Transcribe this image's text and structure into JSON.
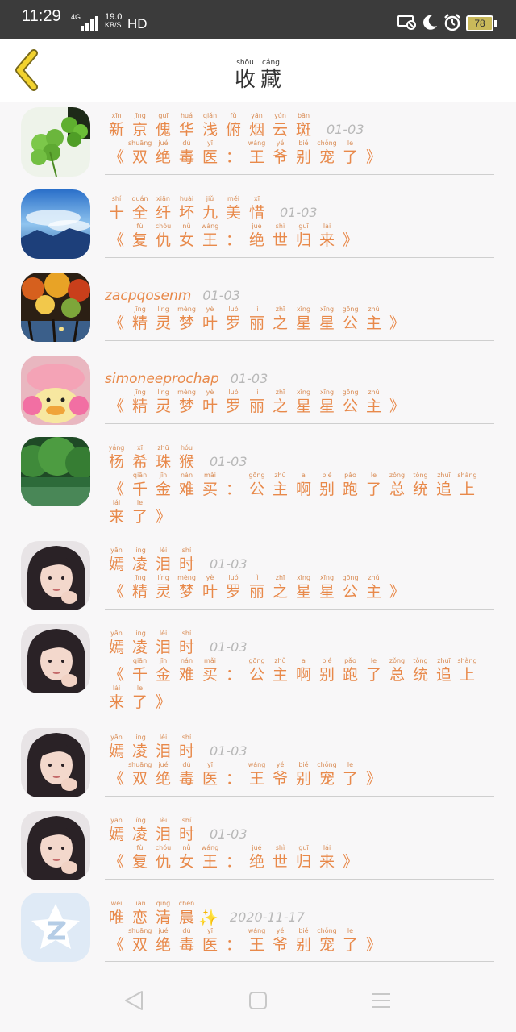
{
  "status_bar": {
    "time": "11:29",
    "network": "4G",
    "speed_value": "19.0",
    "speed_unit": "KB/S",
    "hd": "HD",
    "battery": "78",
    "icons": [
      "screen-cast-icon",
      "moon-icon",
      "alarm-icon"
    ]
  },
  "header": {
    "back_icon": "chevron-left-icon",
    "title": [
      {
        "py": "shōu",
        "hz": "收"
      },
      {
        "py": "cáng",
        "hz": "藏"
      }
    ]
  },
  "items": [
    {
      "name": [
        {
          "py": "xīn",
          "hz": "新"
        },
        {
          "py": "jīng",
          "hz": "京"
        },
        {
          "py": "guī",
          "hz": "傀"
        },
        {
          "py": "huá",
          "hz": "华"
        },
        {
          "py": "qiǎn",
          "hz": "浅"
        },
        {
          "py": "fǔ",
          "hz": "俯"
        },
        {
          "py": "yān",
          "hz": "烟"
        },
        {
          "py": "yún",
          "hz": "云"
        },
        {
          "py": "bān",
          "hz": "斑"
        }
      ],
      "date": "01-03",
      "title": [
        {
          "py": "",
          "hz": "《"
        },
        {
          "py": "shuāng",
          "hz": "双"
        },
        {
          "py": "jué",
          "hz": "绝"
        },
        {
          "py": "dú",
          "hz": "毒"
        },
        {
          "py": "yī",
          "hz": "医"
        },
        {
          "py": "",
          "hz": "："
        },
        {
          "py": "wáng",
          "hz": "王"
        },
        {
          "py": "yé",
          "hz": "爷"
        },
        {
          "py": "bié",
          "hz": "别"
        },
        {
          "py": "chǒng",
          "hz": "宠"
        },
        {
          "py": "le",
          "hz": "了"
        },
        {
          "py": "",
          "hz": "》"
        }
      ]
    },
    {
      "name": [
        {
          "py": "shí",
          "hz": "十"
        },
        {
          "py": "quán",
          "hz": "全"
        },
        {
          "py": "xiān",
          "hz": "纤"
        },
        {
          "py": "huài",
          "hz": "坏"
        },
        {
          "py": "jiǔ",
          "hz": "九"
        },
        {
          "py": "měi",
          "hz": "美"
        },
        {
          "py": "xī",
          "hz": "惜"
        }
      ],
      "date": "01-03",
      "title": [
        {
          "py": "",
          "hz": "《"
        },
        {
          "py": "fù",
          "hz": "复"
        },
        {
          "py": "chóu",
          "hz": "仇"
        },
        {
          "py": "nǚ",
          "hz": "女"
        },
        {
          "py": "wáng",
          "hz": "王"
        },
        {
          "py": "",
          "hz": "："
        },
        {
          "py": "jué",
          "hz": "绝"
        },
        {
          "py": "shì",
          "hz": "世"
        },
        {
          "py": "guī",
          "hz": "归"
        },
        {
          "py": "lái",
          "hz": "来"
        },
        {
          "py": "",
          "hz": "》"
        }
      ]
    },
    {
      "name_text": "zacpqosenm",
      "date": "01-03",
      "title": [
        {
          "py": "",
          "hz": "《"
        },
        {
          "py": "jīng",
          "hz": "精"
        },
        {
          "py": "líng",
          "hz": "灵"
        },
        {
          "py": "mèng",
          "hz": "梦"
        },
        {
          "py": "yè",
          "hz": "叶"
        },
        {
          "py": "luó",
          "hz": "罗"
        },
        {
          "py": "lì",
          "hz": "丽"
        },
        {
          "py": "zhī",
          "hz": "之"
        },
        {
          "py": "xīng",
          "hz": "星"
        },
        {
          "py": "xīng",
          "hz": "星"
        },
        {
          "py": "gōng",
          "hz": "公"
        },
        {
          "py": "zhǔ",
          "hz": "主"
        },
        {
          "py": "",
          "hz": "》"
        }
      ]
    },
    {
      "name_text": "simoneeprochap",
      "date": "01-03",
      "title": [
        {
          "py": "",
          "hz": "《"
        },
        {
          "py": "jīng",
          "hz": "精"
        },
        {
          "py": "líng",
          "hz": "灵"
        },
        {
          "py": "mèng",
          "hz": "梦"
        },
        {
          "py": "yè",
          "hz": "叶"
        },
        {
          "py": "luó",
          "hz": "罗"
        },
        {
          "py": "lì",
          "hz": "丽"
        },
        {
          "py": "zhī",
          "hz": "之"
        },
        {
          "py": "xīng",
          "hz": "星"
        },
        {
          "py": "xīng",
          "hz": "星"
        },
        {
          "py": "gōng",
          "hz": "公"
        },
        {
          "py": "zhǔ",
          "hz": "主"
        },
        {
          "py": "",
          "hz": "》"
        }
      ]
    },
    {
      "name": [
        {
          "py": "yáng",
          "hz": "杨"
        },
        {
          "py": "xī",
          "hz": "希"
        },
        {
          "py": "zhū",
          "hz": "珠"
        },
        {
          "py": "hóu",
          "hz": "猴"
        }
      ],
      "date": "01-03",
      "title": [
        {
          "py": "",
          "hz": "《"
        },
        {
          "py": "qiān",
          "hz": "千"
        },
        {
          "py": "jīn",
          "hz": "金"
        },
        {
          "py": "nán",
          "hz": "难"
        },
        {
          "py": "mǎi",
          "hz": "买"
        },
        {
          "py": "",
          "hz": "："
        },
        {
          "py": "gōng",
          "hz": "公"
        },
        {
          "py": "zhǔ",
          "hz": "主"
        },
        {
          "py": "a",
          "hz": "啊"
        },
        {
          "py": "bié",
          "hz": "别"
        },
        {
          "py": "pǎo",
          "hz": "跑"
        },
        {
          "py": "le",
          "hz": "了"
        },
        {
          "py": "zǒng",
          "hz": "总"
        },
        {
          "py": "tǒng",
          "hz": "统"
        },
        {
          "py": "zhuī",
          "hz": "追"
        },
        {
          "py": "shàng",
          "hz": "上"
        },
        {
          "py": "lái",
          "hz": "来"
        },
        {
          "py": "le",
          "hz": "了"
        },
        {
          "py": "",
          "hz": "》"
        }
      ]
    },
    {
      "name": [
        {
          "py": "yān",
          "hz": "嫣"
        },
        {
          "py": "líng",
          "hz": "凌"
        },
        {
          "py": "lèi",
          "hz": "泪"
        },
        {
          "py": "shí",
          "hz": "时"
        }
      ],
      "date": "01-03",
      "title": [
        {
          "py": "",
          "hz": "《"
        },
        {
          "py": "jīng",
          "hz": "精"
        },
        {
          "py": "líng",
          "hz": "灵"
        },
        {
          "py": "mèng",
          "hz": "梦"
        },
        {
          "py": "yè",
          "hz": "叶"
        },
        {
          "py": "luó",
          "hz": "罗"
        },
        {
          "py": "lì",
          "hz": "丽"
        },
        {
          "py": "zhī",
          "hz": "之"
        },
        {
          "py": "xīng",
          "hz": "星"
        },
        {
          "py": "xīng",
          "hz": "星"
        },
        {
          "py": "gōng",
          "hz": "公"
        },
        {
          "py": "zhǔ",
          "hz": "主"
        },
        {
          "py": "",
          "hz": "》"
        }
      ]
    },
    {
      "name": [
        {
          "py": "yān",
          "hz": "嫣"
        },
        {
          "py": "líng",
          "hz": "凌"
        },
        {
          "py": "lèi",
          "hz": "泪"
        },
        {
          "py": "shí",
          "hz": "时"
        }
      ],
      "date": "01-03",
      "title": [
        {
          "py": "",
          "hz": "《"
        },
        {
          "py": "qiān",
          "hz": "千"
        },
        {
          "py": "jīn",
          "hz": "金"
        },
        {
          "py": "nán",
          "hz": "难"
        },
        {
          "py": "mǎi",
          "hz": "买"
        },
        {
          "py": "",
          "hz": "："
        },
        {
          "py": "gōng",
          "hz": "公"
        },
        {
          "py": "zhǔ",
          "hz": "主"
        },
        {
          "py": "a",
          "hz": "啊"
        },
        {
          "py": "bié",
          "hz": "别"
        },
        {
          "py": "pǎo",
          "hz": "跑"
        },
        {
          "py": "le",
          "hz": "了"
        },
        {
          "py": "zǒng",
          "hz": "总"
        },
        {
          "py": "tǒng",
          "hz": "统"
        },
        {
          "py": "zhuī",
          "hz": "追"
        },
        {
          "py": "shàng",
          "hz": "上"
        },
        {
          "py": "lái",
          "hz": "来"
        },
        {
          "py": "le",
          "hz": "了"
        },
        {
          "py": "",
          "hz": "》"
        }
      ]
    },
    {
      "name": [
        {
          "py": "yān",
          "hz": "嫣"
        },
        {
          "py": "líng",
          "hz": "凌"
        },
        {
          "py": "lèi",
          "hz": "泪"
        },
        {
          "py": "shí",
          "hz": "时"
        }
      ],
      "date": "01-03",
      "title": [
        {
          "py": "",
          "hz": "《"
        },
        {
          "py": "shuāng",
          "hz": "双"
        },
        {
          "py": "jué",
          "hz": "绝"
        },
        {
          "py": "dú",
          "hz": "毒"
        },
        {
          "py": "yī",
          "hz": "医"
        },
        {
          "py": "",
          "hz": "："
        },
        {
          "py": "wáng",
          "hz": "王"
        },
        {
          "py": "yé",
          "hz": "爷"
        },
        {
          "py": "bié",
          "hz": "别"
        },
        {
          "py": "chǒng",
          "hz": "宠"
        },
        {
          "py": "le",
          "hz": "了"
        },
        {
          "py": "",
          "hz": "》"
        }
      ]
    },
    {
      "name": [
        {
          "py": "yān",
          "hz": "嫣"
        },
        {
          "py": "líng",
          "hz": "凌"
        },
        {
          "py": "lèi",
          "hz": "泪"
        },
        {
          "py": "shí",
          "hz": "时"
        }
      ],
      "date": "01-03",
      "title": [
        {
          "py": "",
          "hz": "《"
        },
        {
          "py": "fù",
          "hz": "复"
        },
        {
          "py": "chóu",
          "hz": "仇"
        },
        {
          "py": "nǚ",
          "hz": "女"
        },
        {
          "py": "wáng",
          "hz": "王"
        },
        {
          "py": "",
          "hz": "："
        },
        {
          "py": "jué",
          "hz": "绝"
        },
        {
          "py": "shì",
          "hz": "世"
        },
        {
          "py": "guī",
          "hz": "归"
        },
        {
          "py": "lái",
          "hz": "来"
        },
        {
          "py": "",
          "hz": "》"
        }
      ]
    },
    {
      "name": [
        {
          "py": "wéi",
          "hz": "唯"
        },
        {
          "py": "liàn",
          "hz": "恋"
        },
        {
          "py": "qīng",
          "hz": "清"
        },
        {
          "py": "chén",
          "hz": "晨"
        }
      ],
      "name_suffix": "✨",
      "date": "2020-11-17",
      "title": [
        {
          "py": "",
          "hz": "《"
        },
        {
          "py": "shuāng",
          "hz": "双"
        },
        {
          "py": "jué",
          "hz": "绝"
        },
        {
          "py": "dú",
          "hz": "毒"
        },
        {
          "py": "yī",
          "hz": "医"
        },
        {
          "py": "",
          "hz": "："
        },
        {
          "py": "wáng",
          "hz": "王"
        },
        {
          "py": "yé",
          "hz": "爷"
        },
        {
          "py": "bié",
          "hz": "别"
        },
        {
          "py": "chǒng",
          "hz": "宠"
        },
        {
          "py": "le",
          "hz": "了"
        },
        {
          "py": "",
          "hz": "》"
        }
      ]
    }
  ],
  "avatars": [
    "clover-photo",
    "sky-photo",
    "autumn-painting-photo",
    "pink-duck-photo",
    "forest-photo",
    "girl-portrait-photo",
    "girl-portrait-photo",
    "girl-portrait-photo",
    "girl-portrait-photo",
    "qq-logo-avatar"
  ],
  "nav_bar": {
    "icons": [
      "back-triangle-icon",
      "home-square-icon",
      "menu-lines-icon"
    ]
  }
}
